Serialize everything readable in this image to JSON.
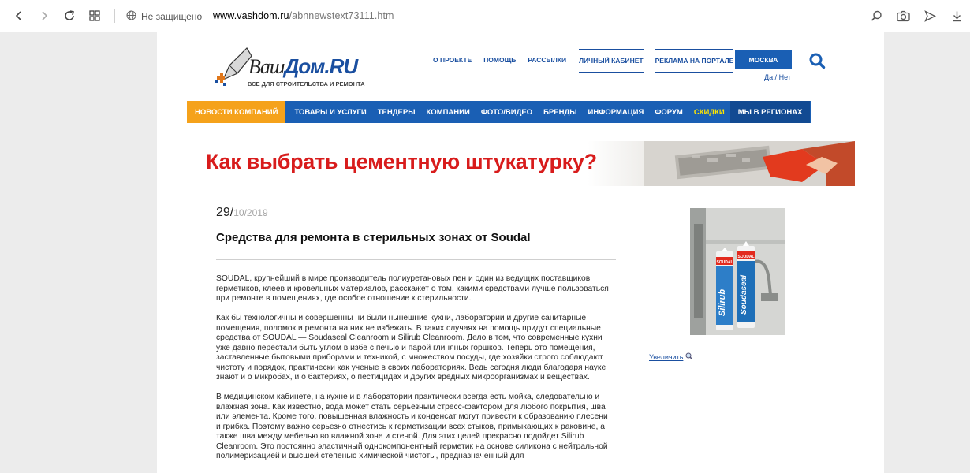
{
  "browser": {
    "security_label": "Не защищено",
    "url_domain": "www.vashdom.ru",
    "url_path": "/abnnewstext73111.htm"
  },
  "header": {
    "logo_word1": "Ваш",
    "logo_word2": "Дом",
    "logo_word3": ".RU",
    "logo_sub": "ВСЕ ДЛЯ СТРОИТЕЛЬСТВА И РЕМОНТА",
    "top_links": [
      "О ПРОЕКТЕ",
      "ПОМОЩЬ",
      "РАССЫЛКИ",
      "ЛИЧНЫЙ КАБИНЕТ",
      "РЕКЛАМА НА ПОРТАЛЕ"
    ],
    "city": "МОСКВА",
    "city_question": "Да / Нет"
  },
  "nav": [
    "НОВОСТИ КОМПАНИЙ",
    "ТОВАРЫ И УСЛУГИ",
    "ТЕНДЕРЫ",
    "КОМПАНИИ",
    "ФОТО/ВИДЕО",
    "БРЕНДЫ",
    "ИНФОРМАЦИЯ",
    "ФОРУМ",
    "СКИДКИ",
    "МЫ В РЕГИОНАХ"
  ],
  "banner": {
    "text": "Как выбрать цементную штукатурку?"
  },
  "article": {
    "date_day": "29/",
    "date_rest": "10/2019",
    "title": "Средства для ремонта в стерильных зонах от Soudal",
    "paragraphs": [
      "SOUDAL, крупнейший в мире производитель полиуретановых пен и один из ведущих поставщиков герметиков, клеев и кровельных материалов, расскажет о том, какими средствами лучше пользоваться при ремонте в помещениях, где особое отношение к стерильности.",
      "Как бы технологичны и совершенны ни были нынешние кухни, лаборатории и другие санитарные помещения, поломок и ремонта на них не избежать. В таких случаях на помощь придут специальные средства от SOUDAL — Soudaseal Cleanroom и Silirub Cleanroom. Дело в том, что современные кухни уже давно перестали быть углом в избе с печью и парой глиняных горшков. Теперь это помещения, заставленные бытовыми приборами и техникой, с множеством посуды, где хозяйки строго соблюдают чистоту и порядок, практически как ученые в своих лабораториях. Ведь сегодня люди благодаря науке знают и о микробах, и о бактериях, о пестицидах и других вредных микроорганизмах и веществах.",
      "В медицинском кабинете, на кухне и в лаборатории практически всегда есть мойка, следовательно и влажная зона. Как известно, вода может стать серьезным стресс-фактором для любого покрытия, шва или элемента. Кроме того, повышенная влажность и конденсат могут привести к образованию плесени и грибка. Поэтому важно серьезно отнестись к герметизации всех стыков, примыкающих к раковине, а также шва между мебелью во влажной зоне и стеной. Для этих целей прекрасно подойдет Silirub Cleanroom. Это постоянно эластичный однокомпонентный герметик на основе силикона с нейтральной полимеризацией и высшей степенью химической чистоты, предназначенный для"
    ],
    "zoom_label": "Увеличить",
    "product_labels": [
      "SOUDAL",
      "Silirub",
      "SOUDAL",
      "Soudaseal"
    ]
  }
}
